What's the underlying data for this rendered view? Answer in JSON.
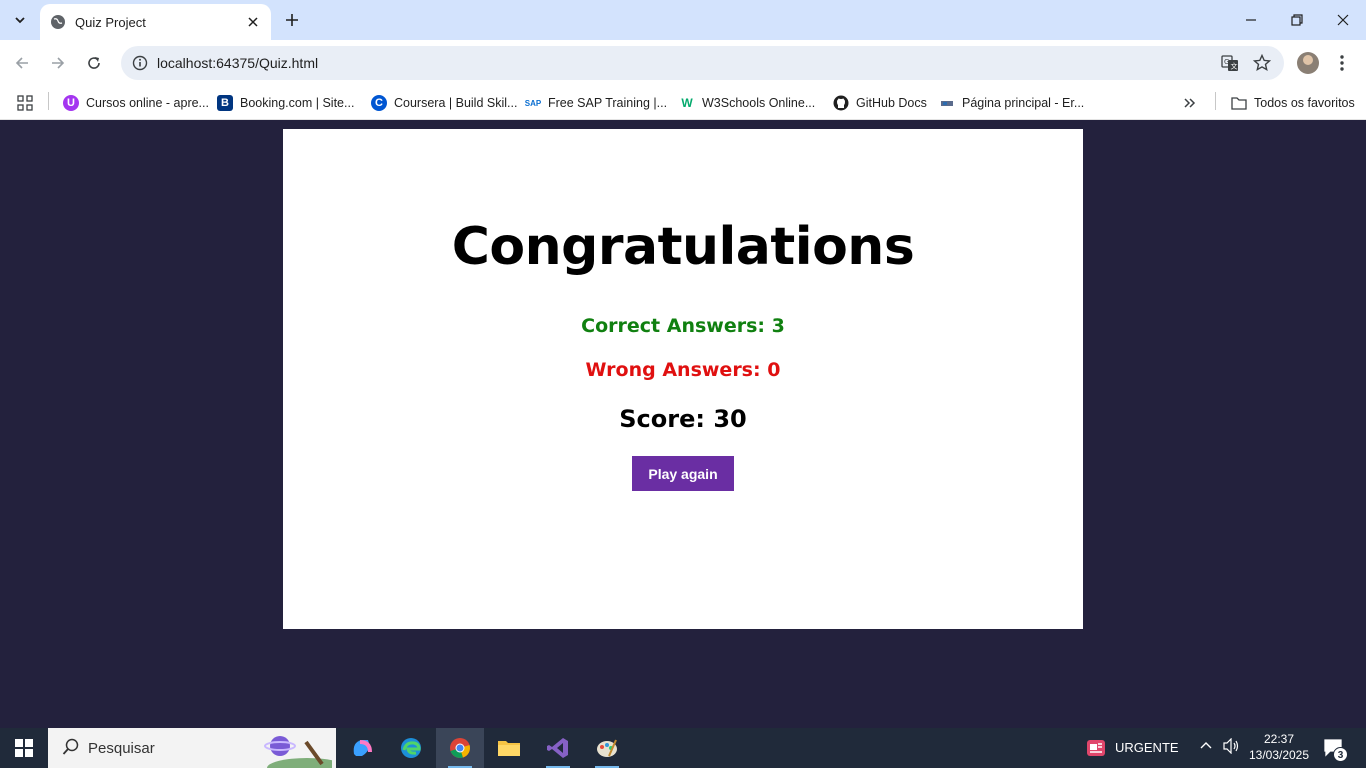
{
  "browser": {
    "tab_title": "Quiz Project",
    "url": "localhost:64375/Quiz.html",
    "bookmarks": [
      "Cursos online - apre...",
      "Booking.com | Site...",
      "Coursera | Build Skil...",
      "Free SAP Training |...",
      "W3Schools Online...",
      "GitHub Docs",
      "Página principal - Er..."
    ],
    "all_bookmarks": "Todos os favoritos"
  },
  "quiz": {
    "title": "Congratulations",
    "correct": "Correct Answers: 3",
    "wrong": "Wrong Answers: 0",
    "score": "Score: 30",
    "play_again": "Play again",
    "colors": {
      "correct": "#108010",
      "wrong": "#e01010",
      "button": "#6a2ea3",
      "background": "#23213d"
    }
  },
  "taskbar": {
    "search_placeholder": "Pesquisar",
    "news_label": "URGENTE",
    "time": "22:37",
    "date": "13/03/2025",
    "notifications": "3"
  }
}
